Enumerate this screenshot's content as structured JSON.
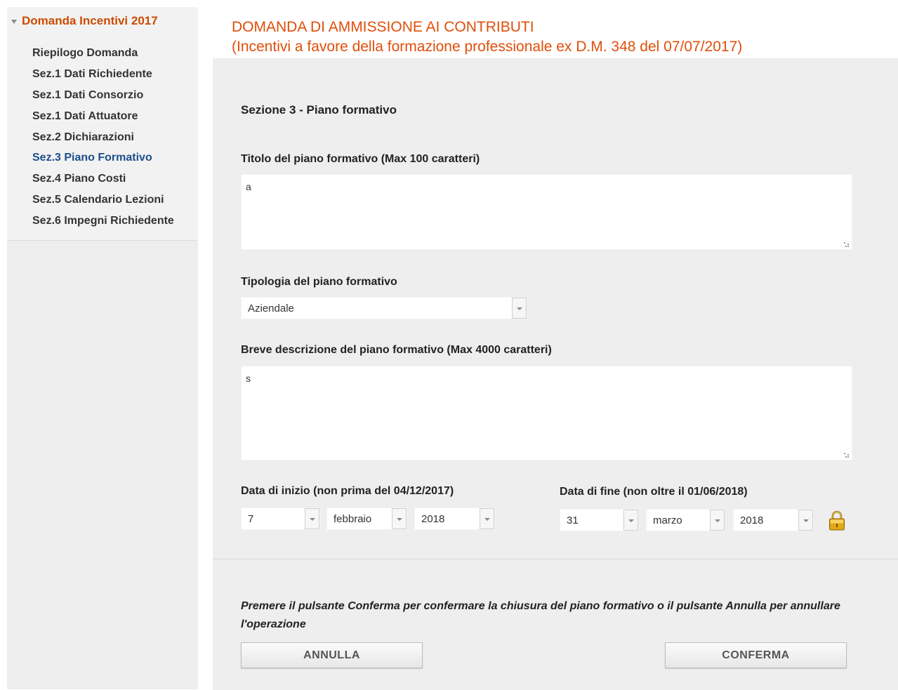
{
  "sidebar": {
    "header": "Domanda Incentivi 2017",
    "items": [
      {
        "label": "Riepilogo Domanda",
        "active": false
      },
      {
        "label": "Sez.1 Dati Richiedente",
        "active": false
      },
      {
        "label": "Sez.1 Dati Consorzio",
        "active": false
      },
      {
        "label": "Sez.1 Dati Attuatore",
        "active": false
      },
      {
        "label": "Sez.2 Dichiarazioni",
        "active": false
      },
      {
        "label": "Sez.3 Piano Formativo",
        "active": true
      },
      {
        "label": "Sez.4 Piano Costi",
        "active": false
      },
      {
        "label": "Sez.5 Calendario Lezioni",
        "active": false
      },
      {
        "label": "Sez.6 Impegni Richiedente",
        "active": false
      }
    ]
  },
  "header": {
    "title_line1": "DOMANDA DI AMMISSIONE AI CONTRIBUTI",
    "title_line2": "(Incentivi a favore della formazione professionale ex D.M. 348 del 07/07/2017)"
  },
  "form": {
    "section_title": "Sezione 3 - Piano formativo",
    "title_field": {
      "label": "Titolo del piano formativo (Max 100 caratteri)",
      "value": "a"
    },
    "type_field": {
      "label": "Tipologia del piano formativo",
      "value": "Aziendale"
    },
    "description_field": {
      "label": "Breve descrizione del piano formativo (Max 4000 caratteri)",
      "value": "s"
    },
    "start_date": {
      "label": "Data di inizio (non prima del 04/12/2017)",
      "day": "7",
      "month": "febbraio",
      "year": "2018"
    },
    "end_date": {
      "label": "Data di fine (non oltre il 01/06/2018)",
      "day": "31",
      "month": "marzo",
      "year": "2018"
    }
  },
  "footer": {
    "note": "Premere il pulsante Conferma per confermare la chiusura del piano formativo o il pulsante Annulla per annullare l'operazione",
    "cancel_label": "ANNULLA",
    "confirm_label": "CONFERMA"
  },
  "colors": {
    "accent": "#e04e0a",
    "active_nav": "#1b4f8c",
    "panel": "#efeeee"
  },
  "icons": {
    "lock": "lock-icon",
    "caret": "caret-down-icon"
  }
}
